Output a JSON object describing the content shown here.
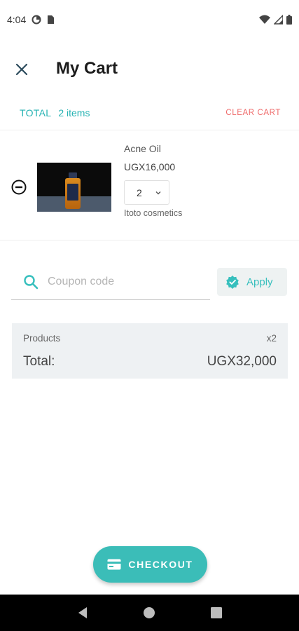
{
  "status_bar": {
    "time": "4:04",
    "icons": [
      "data-saver-icon",
      "sim-card-icon",
      "wifi-icon",
      "signal-icon",
      "battery-icon"
    ]
  },
  "header": {
    "close_icon": "close-icon",
    "title": "My Cart"
  },
  "summary": {
    "total_label": "TOTAL",
    "item_count": "2 items",
    "clear_cart_label": "CLEAR CART"
  },
  "cart": {
    "items": [
      {
        "name": "Acne Oil",
        "price": "UGX16,000",
        "quantity": "2",
        "vendor": "Itoto cosmetics"
      }
    ]
  },
  "coupon": {
    "placeholder": "Coupon code",
    "value": "",
    "apply_label": "Apply"
  },
  "totals": {
    "products_label": "Products",
    "products_count": "x2",
    "total_label": "Total:",
    "total_amount": "UGX32,000"
  },
  "checkout": {
    "label": "CHECKOUT"
  },
  "colors": {
    "accent": "#3bbdb8",
    "danger": "#ef6a6a",
    "card_bg": "#eef1f3"
  }
}
